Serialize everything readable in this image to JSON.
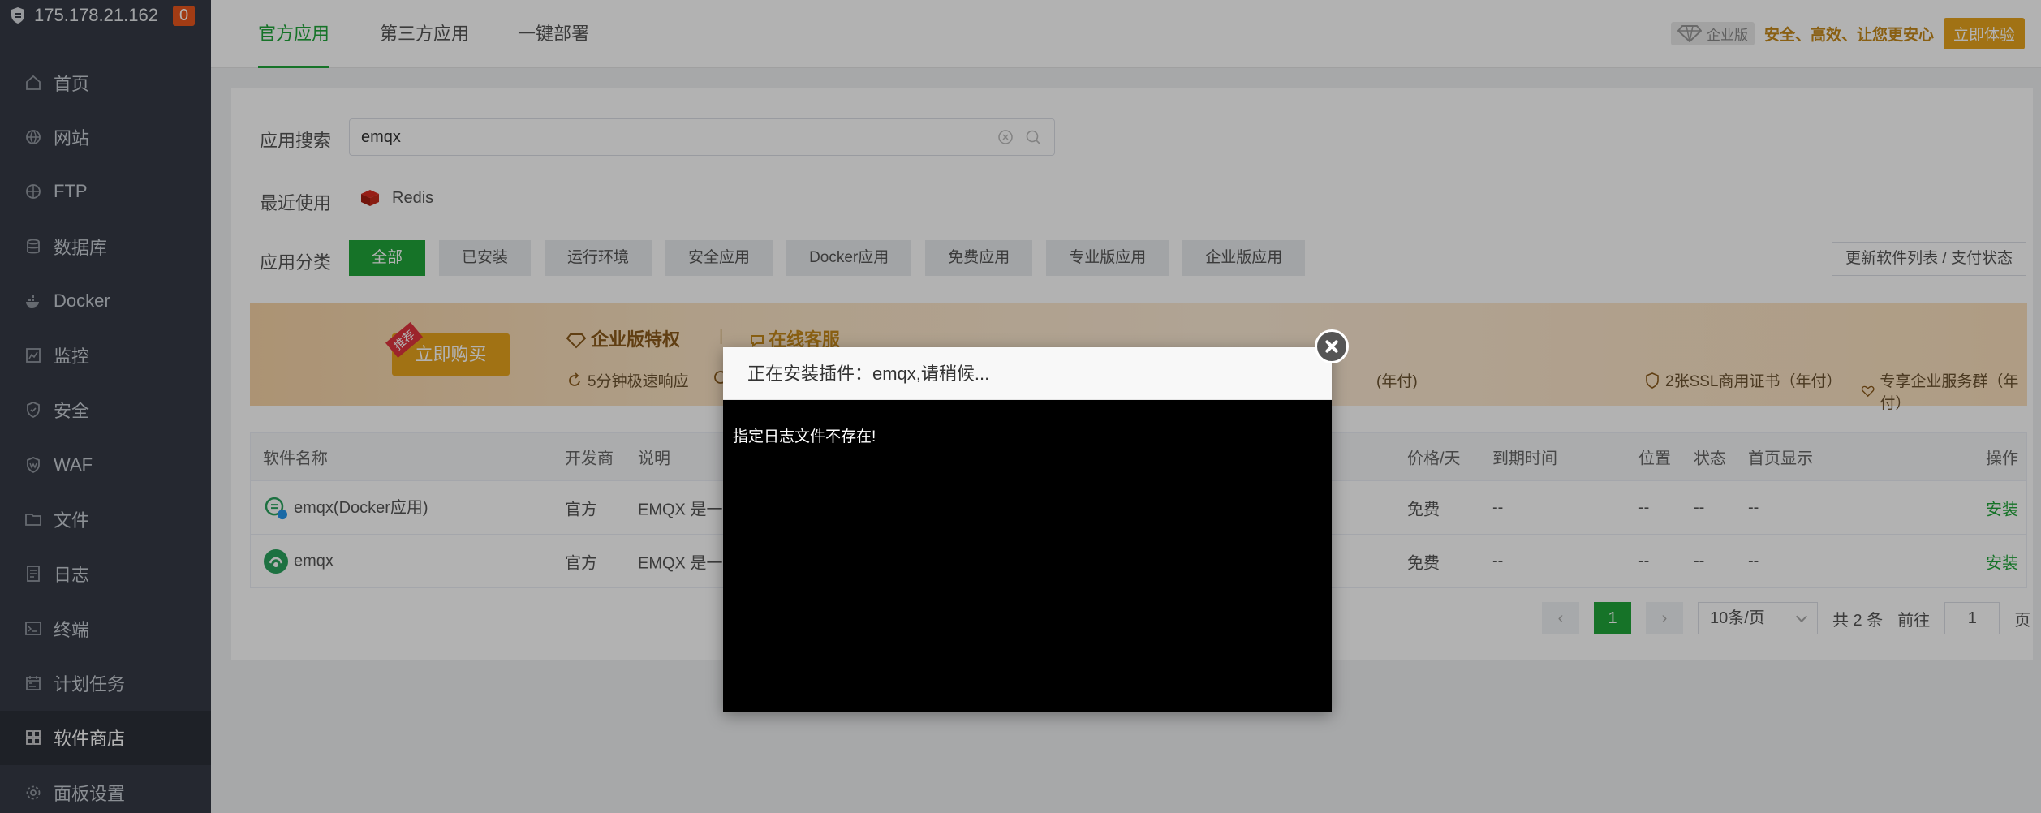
{
  "server": {
    "ip": "175.178.21.162",
    "alert_count": "0"
  },
  "sidebar": {
    "items": [
      {
        "label": "首页",
        "icon": "home-icon"
      },
      {
        "label": "网站",
        "icon": "globe-icon"
      },
      {
        "label": "FTP",
        "icon": "ftp-icon"
      },
      {
        "label": "数据库",
        "icon": "database-icon"
      },
      {
        "label": "Docker",
        "icon": "docker-icon"
      },
      {
        "label": "监控",
        "icon": "monitor-icon"
      },
      {
        "label": "安全",
        "icon": "shield-icon"
      },
      {
        "label": "WAF",
        "icon": "waf-icon"
      },
      {
        "label": "文件",
        "icon": "folder-icon"
      },
      {
        "label": "日志",
        "icon": "log-icon"
      },
      {
        "label": "终端",
        "icon": "terminal-icon"
      },
      {
        "label": "计划任务",
        "icon": "calendar-icon"
      },
      {
        "label": "软件商店",
        "icon": "apps-icon",
        "active": true
      },
      {
        "label": "面板设置",
        "icon": "gear-icon"
      }
    ]
  },
  "tabs": [
    {
      "label": "官方应用",
      "active": true
    },
    {
      "label": "第三方应用"
    },
    {
      "label": "一键部署"
    }
  ],
  "promo_top": {
    "badge": "企业版",
    "slogan": "安全、高效、让您更安心",
    "button": "立即体验"
  },
  "search": {
    "label": "应用搜索",
    "value": "emqx"
  },
  "recent": {
    "label": "最近使用",
    "item": "Redis"
  },
  "categories": {
    "label": "应用分类",
    "items": [
      "全部",
      "已安装",
      "运行环境",
      "安全应用",
      "Docker应用",
      "免费应用",
      "专业版应用",
      "企业版应用"
    ],
    "update_button": "更新软件列表 / 支付状态"
  },
  "banner": {
    "buy_button": "立即购买",
    "buy_tag": "推荐",
    "enterprise_title": "企业版特权",
    "online_service": "在线客服",
    "features": [
      "5分钟极速响应",
      "(年付)",
      "2张SSL商用证书（年付）",
      "专享企业服务群（年付）"
    ]
  },
  "table": {
    "headers": [
      "软件名称",
      "开发商",
      "说明",
      "价格/天",
      "到期时间",
      "位置",
      "状态",
      "首页显示",
      "操作"
    ],
    "rows": [
      {
        "name": "emqx(Docker应用)",
        "dev": "官方",
        "desc": "EMQX 是一款",
        "price": "免费",
        "expire": "--",
        "pos": "--",
        "status": "--",
        "home": "--",
        "action": "安装"
      },
      {
        "name": "emqx",
        "dev": "官方",
        "desc": "EMQX 是一个",
        "price": "免费",
        "expire": "--",
        "pos": "--",
        "status": "--",
        "home": "--",
        "action": "安装"
      }
    ]
  },
  "pagination": {
    "current": "1",
    "page_size": "10条/页",
    "total": "共 2 条",
    "goto_label": "前往",
    "goto_value": "1",
    "goto_suffix": "页"
  },
  "modal": {
    "title": "正在安装插件：emqx,请稍候...",
    "log_text": "指定日志文件不存在!"
  },
  "colors": {
    "accent": "#20a53a",
    "sidebar_bg": "#353a45",
    "gold": "#e7a41e"
  }
}
